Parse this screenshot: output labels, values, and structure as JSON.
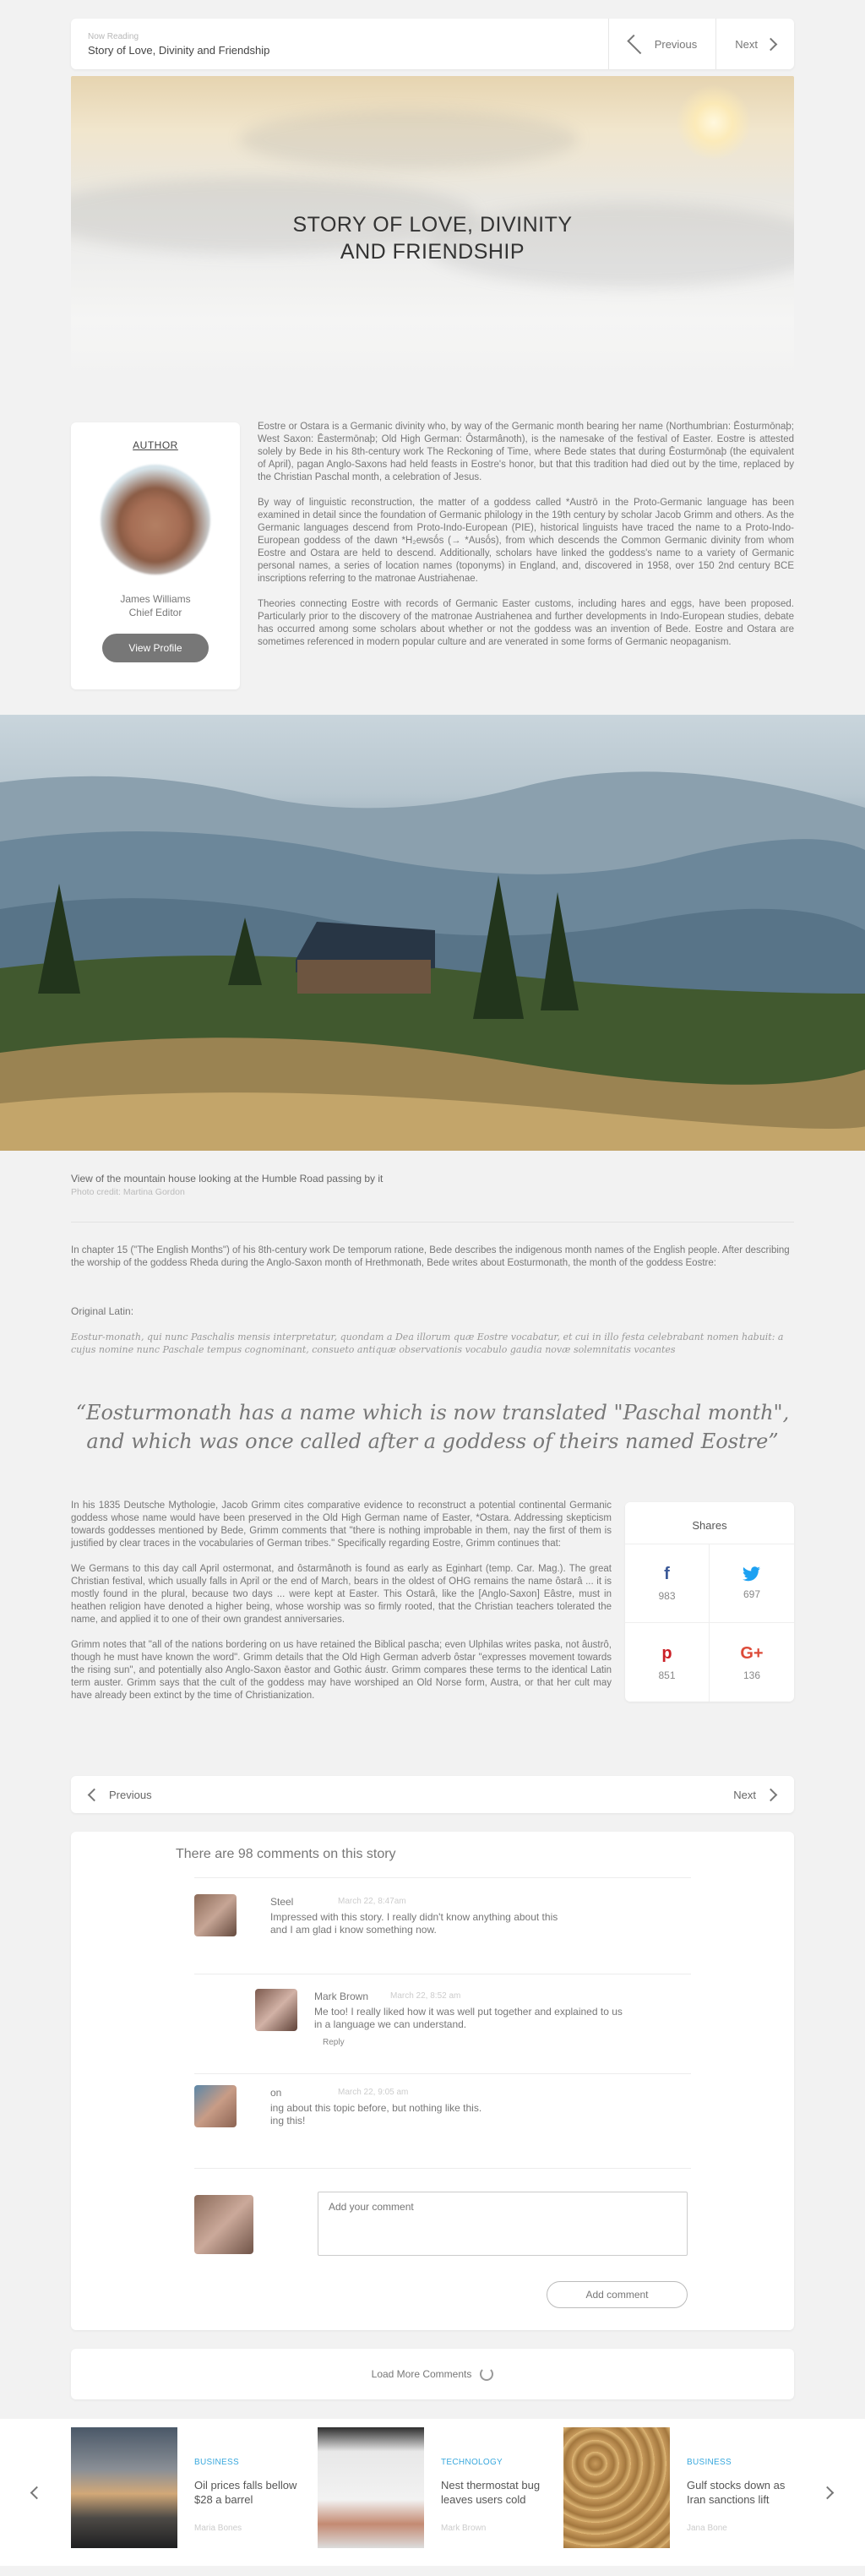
{
  "topbar": {
    "small_label": "Now Reading",
    "title": "Story of Love, Divinity and Friendship",
    "prev": "Previous",
    "next": "Next"
  },
  "hero": {
    "title_line1": "STORY OF LOVE, DIVINITY",
    "title_line2": "AND FRIENDSHIP"
  },
  "author": {
    "label": "AUTHOR",
    "name": "James Williams",
    "role": "Chief Editor",
    "button": "View Profile"
  },
  "intro": {
    "p1": "Eostre or Ostara is a Germanic divinity who, by way of the Germanic month bearing her name (Northumbrian: Ēosturmōnaþ; West Saxon: Ēastermōnaþ; Old High German: Ôstarmânoth), is the namesake of the festival of Easter. Eostre is attested solely by Bede in his 8th-century work The Reckoning of Time, where Bede states that during Ēosturmōnaþ (the equivalent of April), pagan Anglo-Saxons had held feasts in Eostre's honor, but that this tradition had died out by the time, replaced by the Christian Paschal month, a celebration of Jesus.",
    "p2": "By way of linguistic reconstruction, the matter of a goddess called *Austrō in the Proto-Germanic language has been examined in detail since the foundation of Germanic philology in the 19th century by scholar Jacob Grimm and others. As the Germanic languages descend from Proto-Indo-European (PIE), historical linguists have traced the name to a Proto-Indo-European goddess of the dawn *H₂ewsṓs (→ *Ausṓs), from which descends the Common Germanic divinity from whom Eostre and Ostara are held to descend. Additionally, scholars have linked the goddess's name to a variety of Germanic personal names, a series of location names (toponyms) in England, and, discovered in 1958, over 150 2nd century BCE inscriptions referring to the matronae Austriahenae.",
    "p3": "Theories connecting Eostre with records of Germanic Easter customs, including hares and eggs, have been proposed. Particularly prior to the discovery of the matronae Austriahenea and further developments in Indo-European studies, debate has occurred among some scholars about whether or not the goddess was an invention of Bede. Eostre and Ostara are sometimes referenced in modern popular culture and are venerated in some forms of Germanic neopaganism."
  },
  "photo": {
    "caption": "View of the mountain house looking at the Humble Road passing by it",
    "credit": "Photo credit: Martina Gordon"
  },
  "body1": "In chapter 15 (\"The English Months\") of his 8th-century work De temporum ratione, Bede describes the indigenous month names of the English people. After describing the worship of the goddess Rheda during the Anglo-Saxon month of Hrethmonath, Bede writes about Eosturmonath, the month of the goddess Eostre:",
  "original_label": "Original Latin:",
  "latin": "Eostur-monath, qui nunc Paschalis mensis interpretatur, quondam a Dea illorum quæ Eostre vocabatur, et cui in illo festa celebrabant nomen habuit: a cujus nomine nunc Paschale tempus cognominant, consueto antiquæ observationis vocabulo gaudia novæ solemnitatis vocantes",
  "quote": {
    "line1": "“Eosturmonath has a name which is now translated \"Paschal month\",",
    "line2": "and which was once called after a goddess of theirs named Eostre”"
  },
  "body2": {
    "p1": "In his 1835 Deutsche Mythologie, Jacob Grimm cites comparative evidence to reconstruct a potential continental Germanic goddess whose name would have been preserved in the Old High German name of Easter, *Ostara. Addressing skepticism towards goddesses mentioned by Bede, Grimm comments that \"there is nothing improbable in them, nay the first of them is justified by clear traces in the vocabularies of German tribes.\" Specifically regarding Eostre, Grimm continues that:",
    "p2": "We Germans to this day call April ostermonat, and ôstarmânoth is found as early as Eginhart (temp. Car. Mag.). The great Christian festival, which usually falls in April or the end of March, bears in the oldest of OHG remains the name ôstarâ ... it is mostly found in the plural, because two days ... were kept at Easter. This Ostarâ, like the [Anglo-Saxon] Eâstre, must in heathen religion have denoted a higher being, whose worship was so firmly rooted, that the Christian teachers tolerated the name, and applied it to one of their own grandest anniversaries.",
    "p3": "Grimm notes that \"all of the nations bordering on us have retained the Biblical pascha; even Ulphilas writes paska, not âustrô, though he must have known the word\". Grimm details that the Old High German adverb ôstar \"expresses movement towards the rising sun\", and potentially also Anglo-Saxon ēastor and Gothic áustr. Grimm compares these terms to the identical Latin term auster. Grimm says that the cult of the goddess may have worshiped an Old Norse form, Austra, or that her cult may have already been extinct by the time of Christianization."
  },
  "shares": {
    "title": "Shares",
    "items": [
      {
        "icon": "f",
        "name": "facebook",
        "count": "983",
        "color": "#3b5998"
      },
      {
        "icon": "t",
        "name": "twitter",
        "count": "697",
        "color": "#1da1f2"
      },
      {
        "icon": "p",
        "name": "pinterest",
        "count": "851",
        "color": "#cb2027"
      },
      {
        "icon": "G+",
        "name": "google-plus",
        "count": "136",
        "color": "#dd4b39"
      }
    ]
  },
  "bottomnav": {
    "prev": "Previous",
    "next": "Next"
  },
  "comments": {
    "title": "There are 98 comments on this story",
    "items": [
      {
        "name": "Steel",
        "date": "March 22, 8:47am",
        "text1": "Impressed with this story. I really didn't know anything about this",
        "text2": "and I am glad i know something now."
      },
      {
        "name": "Mark Brown",
        "date": "March 22, 8:52 am",
        "text1": "Me too! I really liked how it was well put together and explained to us",
        "text2": "in a language we can understand.",
        "reply": "Reply"
      },
      {
        "name": "on",
        "date": "March 22, 9:05 am",
        "text1": "ing about this topic before, but nothing like this.",
        "text2": "ing this!"
      }
    ],
    "placeholder": "Add your comment",
    "add_button": "Add comment"
  },
  "load_more": "Load More Comments",
  "related": [
    {
      "category": "BUSINESS",
      "headline": "Oil prices falls bellow $28 a barrel",
      "author": "Maria Bones"
    },
    {
      "category": "TECHNOLOGY",
      "headline": "Nest thermostat bug leaves users cold",
      "author": "Mark Brown"
    },
    {
      "category": "BUSINESS",
      "headline": "Gulf stocks down as Iran sanctions lift",
      "author": "Jana Bone"
    }
  ]
}
